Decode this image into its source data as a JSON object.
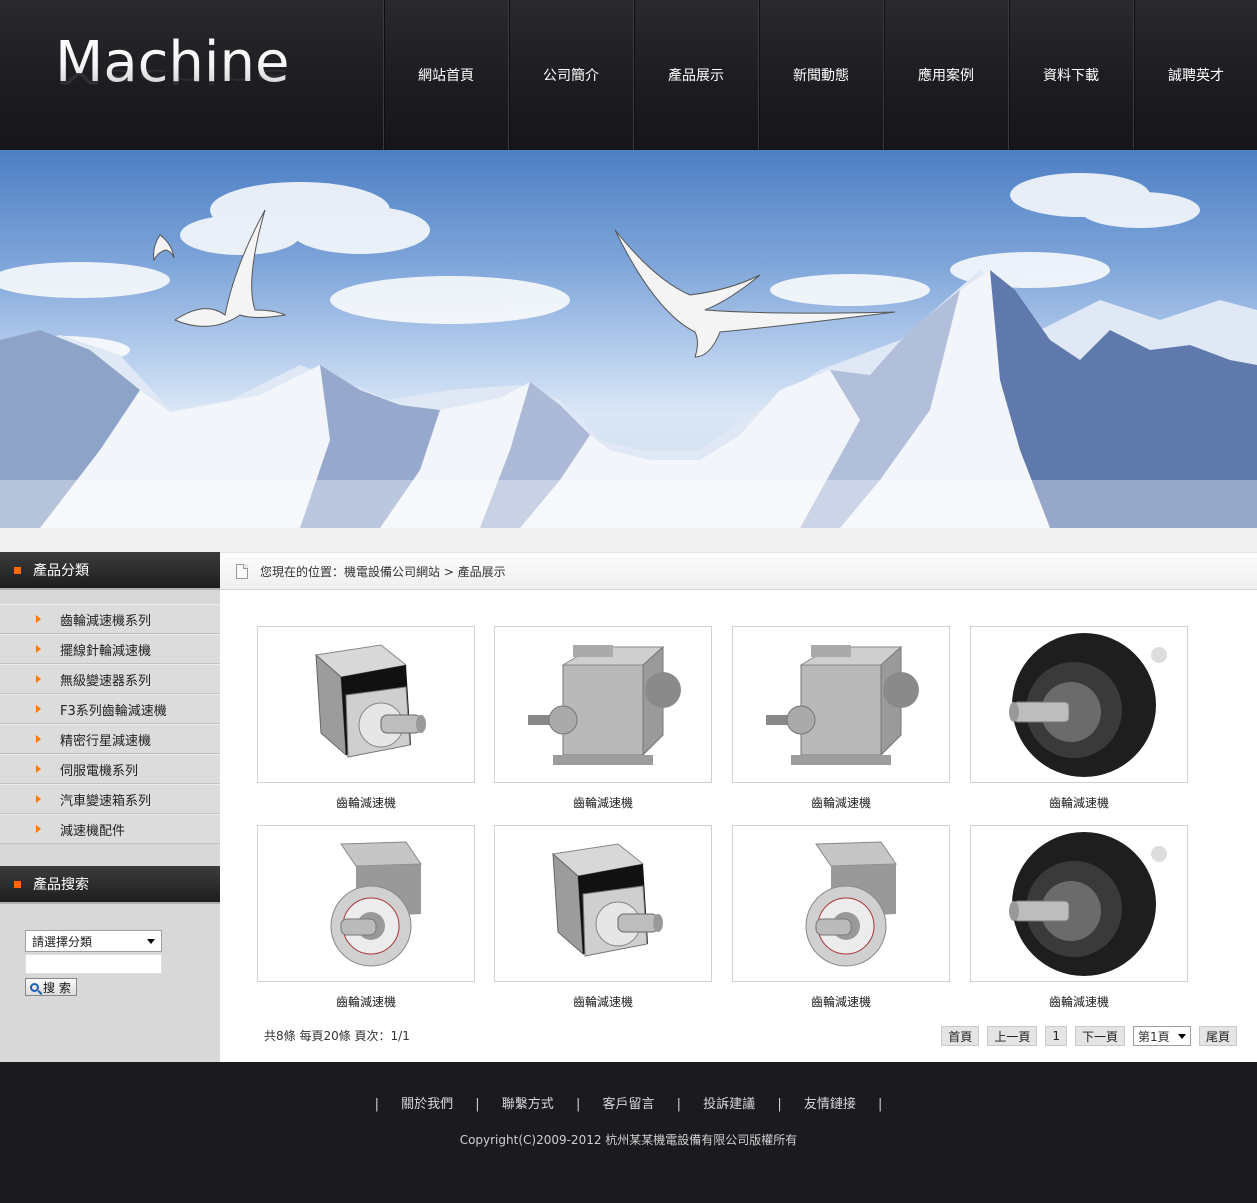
{
  "header": {
    "logo": "Machine",
    "nav": [
      "網站首頁",
      "公司簡介",
      "產品展示",
      "新聞動態",
      "應用案例",
      "資料下載",
      "誠聘英才"
    ]
  },
  "sidebar": {
    "category_title": "產品分類",
    "categories": [
      "齒輪減速機系列",
      "擺線針輪減速機",
      "無級變速器系列",
      "F3系列齒輪減速機",
      "精密行星減速機",
      "伺服電機系列",
      "汽車變速箱系列",
      "減速機配件"
    ],
    "search_title": "產品搜索",
    "search_select": "請選擇分類",
    "search_button": "搜 索"
  },
  "breadcrumb": {
    "text": "您現在的位置：機電設備公司網站 > 產品展示"
  },
  "products": [
    {
      "name": "齒輪減速機",
      "icon": "planetary-gearbox-icon"
    },
    {
      "name": "齒輪減速機",
      "icon": "helical-gearbox-icon"
    },
    {
      "name": "齒輪減速機",
      "icon": "helical-gearbox-icon"
    },
    {
      "name": "齒輪減速機",
      "icon": "hydraulic-motor-icon"
    },
    {
      "name": "齒輪減速機",
      "icon": "flange-gearbox-icon"
    },
    {
      "name": "齒輪減速機",
      "icon": "planetary-gearbox-icon"
    },
    {
      "name": "齒輪減速機",
      "icon": "flange-gearbox-icon"
    },
    {
      "name": "齒輪減速機",
      "icon": "hydraulic-motor-icon"
    }
  ],
  "pager": {
    "info": "共8條 每頁20條 頁次：1/1",
    "first": "首頁",
    "prev": "上一頁",
    "current": "1",
    "next": "下一頁",
    "select": "第1頁",
    "last": "尾頁"
  },
  "footer": {
    "links": [
      "關於我們",
      "聯繫方式",
      "客戶留言",
      "投訴建議",
      "友情鏈接"
    ],
    "separator": "|",
    "copyright": "Copyright(C)2009-2012 杭州某某機電設備有限公司版權所有"
  },
  "colors": {
    "header_bg": "#1d1d21",
    "accent_orange": "#ff6a00",
    "sidebar_bg": "#d8d8d8",
    "footer_bg": "#1b1b1f"
  }
}
